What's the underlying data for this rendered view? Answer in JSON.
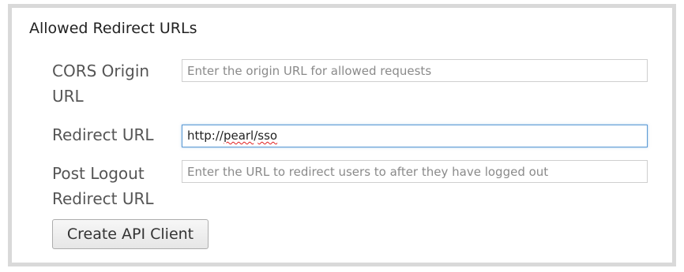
{
  "panel": {
    "title": "Allowed Redirect URLs"
  },
  "fields": {
    "cors_origin": {
      "label": "CORS Origin URL",
      "placeholder": "Enter the origin URL for allowed requests",
      "value": ""
    },
    "redirect": {
      "label": "Redirect URL",
      "value_prefix": "http://",
      "value_word_1": "pearl",
      "value_sep": "/",
      "value_word_2": "sso"
    },
    "post_logout_redirect": {
      "label": "Post Logout Redirect URL",
      "placeholder": "Enter the URL to redirect users to after they have logged out",
      "value": ""
    }
  },
  "actions": {
    "create_label": "Create API Client"
  },
  "colors": {
    "panel_border": "#d9d9d9",
    "focus_border": "#5b9ad5",
    "spellcheck_underline": "#e02020"
  }
}
